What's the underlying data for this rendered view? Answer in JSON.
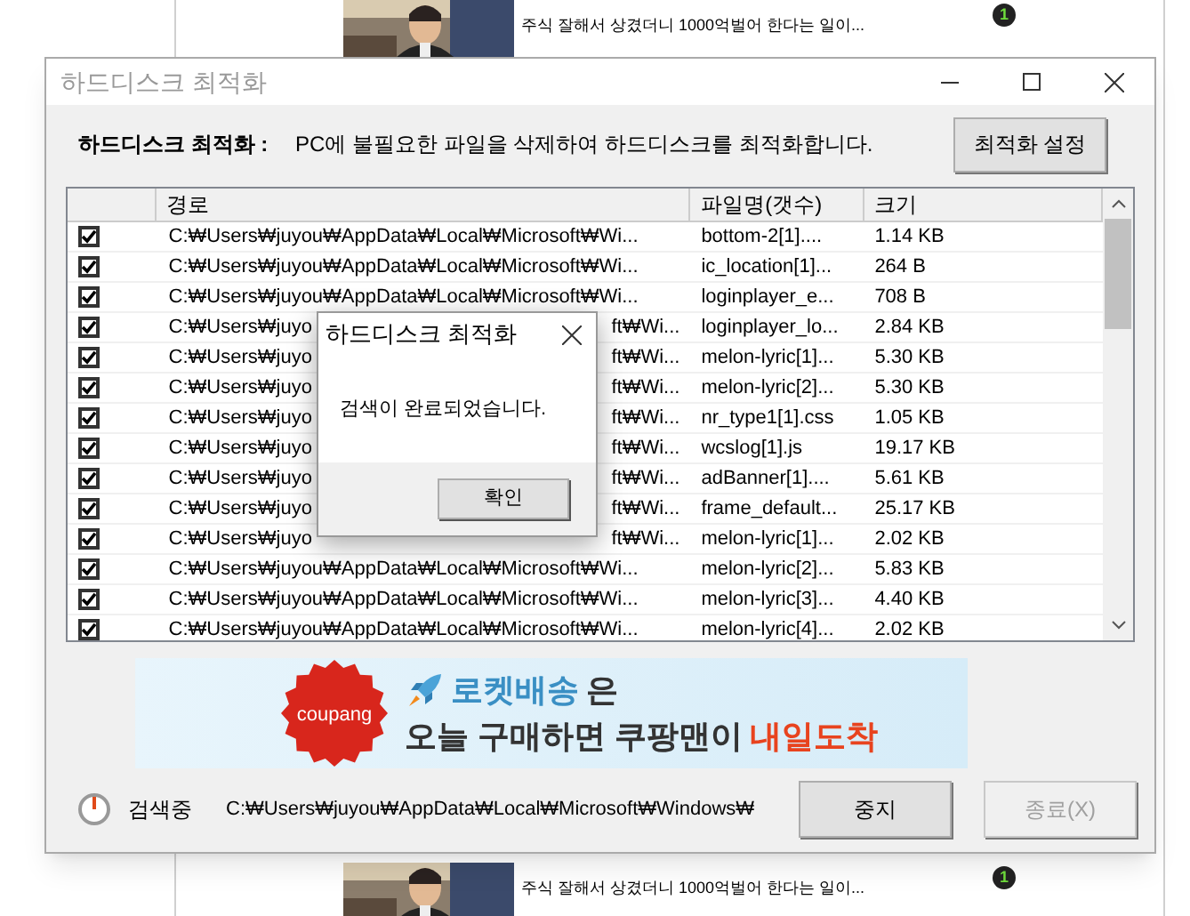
{
  "background_page": {
    "news": [
      {
        "headline": "주식 잘해서 상겼더니 1000억벌어 한다는 일이...",
        "badge": "1"
      },
      {
        "headline": "주식 잘해서 상겼더니 1000억벌어 한다는 일이...",
        "badge": "1"
      }
    ]
  },
  "window": {
    "title": "하드디스크 최적화",
    "active": false
  },
  "header": {
    "label": "하드디스크 최적화 :",
    "description": "PC에 불필요한 파일을 삭제하여 하드디스크를 최적화합니다.",
    "button": "최적화 설정"
  },
  "table": {
    "columns": [
      "경로",
      "파일명(갯수)",
      "크기"
    ],
    "rows": [
      {
        "checked": true,
        "path": "C:₩Users₩juyou₩AppData₩Local₩Microsoft₩Wi...",
        "file": "bottom-2[1]....",
        "size": "1.14 KB"
      },
      {
        "checked": true,
        "path": "C:₩Users₩juyou₩AppData₩Local₩Microsoft₩Wi...",
        "file": "ic_location[1]...",
        "size": "264 B"
      },
      {
        "checked": true,
        "path": "C:₩Users₩juyou₩AppData₩Local₩Microsoft₩Wi...",
        "file": "loginplayer_e...",
        "size": "708 B"
      },
      {
        "checked": true,
        "path_parts": [
          "C:₩Users₩juyo",
          "ft₩Wi..."
        ],
        "file": "loginplayer_lo...",
        "size": "2.84 KB"
      },
      {
        "checked": true,
        "path_parts": [
          "C:₩Users₩juyo",
          "ft₩Wi..."
        ],
        "file": "melon-lyric[1]...",
        "size": "5.30 KB"
      },
      {
        "checked": true,
        "path_parts": [
          "C:₩Users₩juyo",
          "ft₩Wi..."
        ],
        "file": "melon-lyric[2]...",
        "size": "5.30 KB"
      },
      {
        "checked": true,
        "path_parts": [
          "C:₩Users₩juyo",
          "ft₩Wi..."
        ],
        "file": "nr_type1[1].css",
        "size": "1.05 KB"
      },
      {
        "checked": true,
        "path_parts": [
          "C:₩Users₩juyo",
          "ft₩Wi..."
        ],
        "file": "wcslog[1].js",
        "size": "19.17 KB"
      },
      {
        "checked": true,
        "path_parts": [
          "C:₩Users₩juyo",
          "ft₩Wi..."
        ],
        "file": "adBanner[1]....",
        "size": "5.61 KB"
      },
      {
        "checked": true,
        "path_parts": [
          "C:₩Users₩juyo",
          "ft₩Wi..."
        ],
        "file": "frame_default...",
        "size": "25.17 KB"
      },
      {
        "checked": true,
        "path_parts": [
          "C:₩Users₩juyo",
          "ft₩Wi..."
        ],
        "file": "melon-lyric[1]...",
        "size": "2.02 KB"
      },
      {
        "checked": true,
        "path": "C:₩Users₩juyou₩AppData₩Local₩Microsoft₩Wi...",
        "file": "melon-lyric[2]...",
        "size": "5.83 KB"
      },
      {
        "checked": true,
        "path": "C:₩Users₩juyou₩AppData₩Local₩Microsoft₩Wi...",
        "file": "melon-lyric[3]...",
        "size": "4.40 KB"
      },
      {
        "checked": true,
        "path": "C:₩Users₩juyou₩AppData₩Local₩Microsoft₩Wi...",
        "file": "melon-lyric[4]...",
        "size": "2.02 KB"
      }
    ]
  },
  "banner": {
    "logo": "coupang",
    "lines": [
      [
        {
          "text": "로켓배송",
          "kind": "highlight"
        },
        {
          "text": "은",
          "kind": "plain"
        }
      ],
      [
        {
          "text": "오늘 구매하면 쿠팡맨이",
          "kind": "plain"
        },
        {
          "text": "내일도착",
          "kind": "accent"
        }
      ]
    ]
  },
  "status": {
    "label": "검색중",
    "path": "C:₩Users₩juyou₩AppData₩Local₩Microsoft₩Windows₩",
    "buttons": [
      {
        "label": "중지",
        "disabled": false
      },
      {
        "label": "종료(X)",
        "disabled": true
      }
    ]
  },
  "dialog": {
    "title": "하드디스크 최적화",
    "message": "검색이 완료되었습니다.",
    "button": "확인"
  }
}
